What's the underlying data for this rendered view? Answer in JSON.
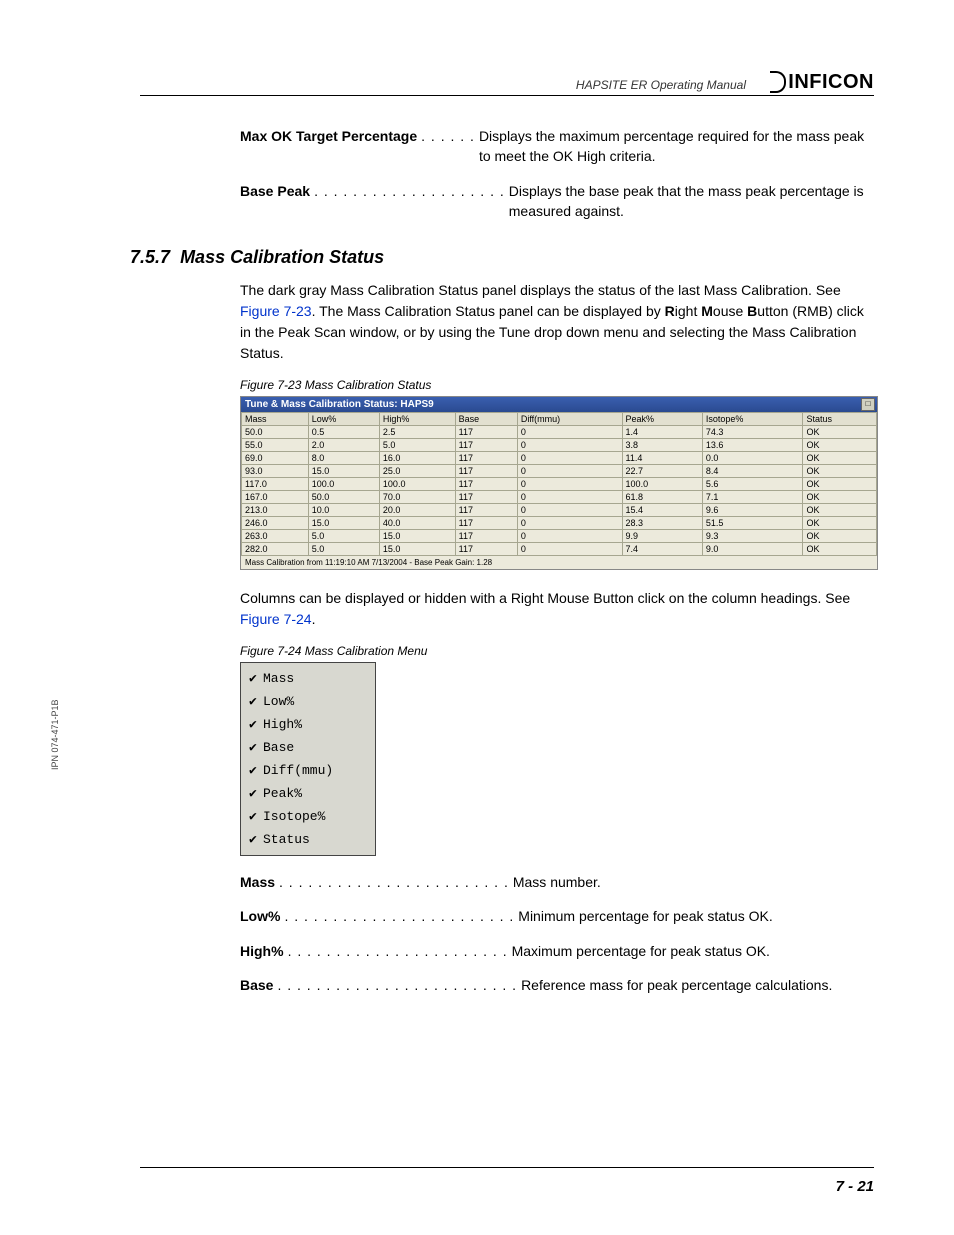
{
  "header": {
    "manual_title": "HAPSITE ER Operating Manual",
    "brand": "INFICON"
  },
  "defs_top": [
    {
      "term": "Max OK Target Percentage",
      "dots": ". . . . . .",
      "desc": "Displays the maximum percentage required for the mass peak to meet the OK High criteria."
    },
    {
      "term": "Base Peak",
      "dots": ". . . . . . . . . . . . . . . . . . . .",
      "desc": "Displays the base peak that the mass peak percentage is measured against."
    }
  ],
  "section": {
    "number": "7.5.7",
    "title": "Mass Calibration Status"
  },
  "para1_a": "The dark gray Mass Calibration Status panel displays the status of the last Mass Calibration. See ",
  "para1_link": "Figure 7-23",
  "para1_b": ". The Mass Calibration Status panel can be displayed by ",
  "para1_r": "R",
  "para1_c": "ight ",
  "para1_m": "M",
  "para1_d": "ouse ",
  "para1_bb": "B",
  "para1_e": "utton (RMB) click in the Peak Scan window, or by using the Tune drop down menu and selecting the Mass Calibration Status.",
  "fig23_caption": "Figure 7-23  Mass Calibration Status",
  "calib": {
    "title": "Tune & Mass Calibration Status: HAPS9",
    "headers": [
      "Mass",
      "Low%",
      "High%",
      "Base",
      "Diff(mmu)",
      "Peak%",
      "Isotope%",
      "Status"
    ],
    "rows": [
      [
        "50.0",
        "0.5",
        "2.5",
        "117",
        "0",
        "1.4",
        "74.3",
        "OK"
      ],
      [
        "55.0",
        "2.0",
        "5.0",
        "117",
        "0",
        "3.8",
        "13.6",
        "OK"
      ],
      [
        "69.0",
        "8.0",
        "16.0",
        "117",
        "0",
        "11.4",
        "0.0",
        "OK"
      ],
      [
        "93.0",
        "15.0",
        "25.0",
        "117",
        "0",
        "22.7",
        "8.4",
        "OK"
      ],
      [
        "117.0",
        "100.0",
        "100.0",
        "117",
        "0",
        "100.0",
        "5.6",
        "OK"
      ],
      [
        "167.0",
        "50.0",
        "70.0",
        "117",
        "0",
        "61.8",
        "7.1",
        "OK"
      ],
      [
        "213.0",
        "10.0",
        "20.0",
        "117",
        "0",
        "15.4",
        "9.6",
        "OK"
      ],
      [
        "246.0",
        "15.0",
        "40.0",
        "117",
        "0",
        "28.3",
        "51.5",
        "OK"
      ],
      [
        "263.0",
        "5.0",
        "15.0",
        "117",
        "0",
        "9.9",
        "9.3",
        "OK"
      ],
      [
        "282.0",
        "5.0",
        "15.0",
        "117",
        "0",
        "7.4",
        "9.0",
        "OK"
      ]
    ],
    "footer": "Mass Calibration from 11:19:10 AM 7/13/2004 - Base Peak Gain: 1.28"
  },
  "para2_a": "Columns can be displayed or hidden with a Right Mouse Button click on the column headings. See ",
  "para2_link": "Figure 7-24",
  "para2_b": ".",
  "fig24_caption": "Figure 7-24  Mass Calibration Menu",
  "menu_items": [
    "Mass",
    "Low%",
    "High%",
    "Base",
    "Diff(mmu)",
    "Peak%",
    "Isotope%",
    "Status"
  ],
  "defs_bottom": [
    {
      "term": "Mass",
      "dots": " . . . . . . . . . . . . . . . . . . . . . . . .",
      "desc": "Mass number."
    },
    {
      "term": "Low%",
      "dots": ". . . . . . . . . . . . . . . . . . . . . . . .",
      "desc": "Minimum percentage for peak status OK."
    },
    {
      "term": "High%",
      "dots": " . . . . . . . . . . . . . . . . . . . . . . .",
      "desc": "Maximum percentage for peak status OK."
    },
    {
      "term": "Base",
      "dots": ". . . . . . . . . . . . . . . . . . . . . . . . .",
      "desc": "Reference mass for peak percentage calculations."
    }
  ],
  "side_ipn": "IPN 074-471-P1B",
  "page_number": "7 - 21"
}
